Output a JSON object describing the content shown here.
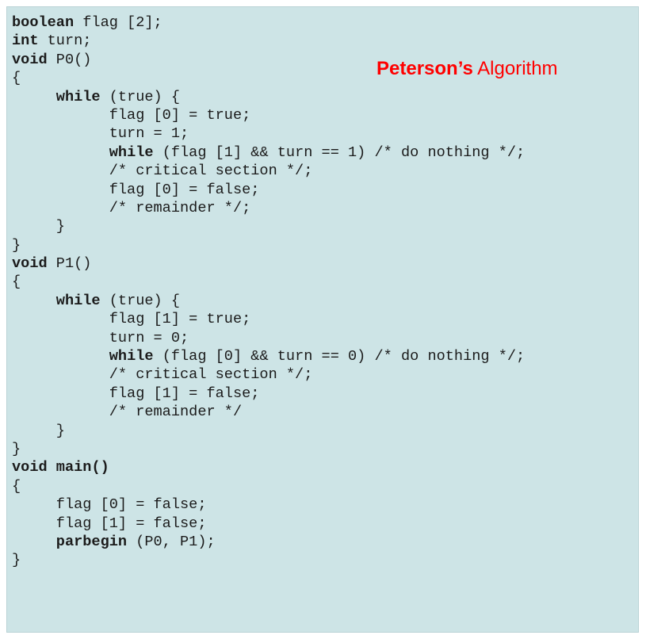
{
  "title": {
    "bold": "Peterson’s",
    "rest": " Algorithm"
  },
  "code_lines": [
    [
      {
        "t": "boolean",
        "k": 1
      },
      {
        "t": " flag [2];",
        "k": 0
      }
    ],
    [
      {
        "t": "int",
        "k": 1
      },
      {
        "t": " turn;",
        "k": 0
      }
    ],
    [
      {
        "t": "void",
        "k": 1
      },
      {
        "t": " P0()",
        "k": 0
      }
    ],
    [
      {
        "t": "{",
        "k": 0
      }
    ],
    [
      {
        "t": "     ",
        "k": 0
      },
      {
        "t": "while",
        "k": 1
      },
      {
        "t": " (true) {",
        "k": 0
      }
    ],
    [
      {
        "t": "           flag [0] = true;",
        "k": 0
      }
    ],
    [
      {
        "t": "           turn = 1;",
        "k": 0
      }
    ],
    [
      {
        "t": "           ",
        "k": 0
      },
      {
        "t": "while",
        "k": 1
      },
      {
        "t": " (flag [1] && turn == 1) /* do nothing */;",
        "k": 0
      }
    ],
    [
      {
        "t": "           /* critical section */;",
        "k": 0
      }
    ],
    [
      {
        "t": "           flag [0] = false;",
        "k": 0
      }
    ],
    [
      {
        "t": "           /* remainder */;",
        "k": 0
      }
    ],
    [
      {
        "t": "     }",
        "k": 0
      }
    ],
    [
      {
        "t": "}",
        "k": 0
      }
    ],
    [
      {
        "t": "void",
        "k": 1
      },
      {
        "t": " P1()",
        "k": 0
      }
    ],
    [
      {
        "t": "{",
        "k": 0
      }
    ],
    [
      {
        "t": "     ",
        "k": 0
      },
      {
        "t": "while",
        "k": 1
      },
      {
        "t": " (true) {",
        "k": 0
      }
    ],
    [
      {
        "t": "           flag [1] = true;",
        "k": 0
      }
    ],
    [
      {
        "t": "           turn = 0;",
        "k": 0
      }
    ],
    [
      {
        "t": "           ",
        "k": 0
      },
      {
        "t": "while",
        "k": 1
      },
      {
        "t": " (flag [0] && turn == 0) /* do nothing */;",
        "k": 0
      }
    ],
    [
      {
        "t": "           /* critical section */;",
        "k": 0
      }
    ],
    [
      {
        "t": "           flag [1] = false;",
        "k": 0
      }
    ],
    [
      {
        "t": "           /* remainder */",
        "k": 0
      }
    ],
    [
      {
        "t": "     }",
        "k": 0
      }
    ],
    [
      {
        "t": "}",
        "k": 0
      }
    ],
    [
      {
        "t": "void main",
        "k": 1
      },
      {
        "t": "()",
        "k": 1
      }
    ],
    [
      {
        "t": "{",
        "k": 0
      }
    ],
    [
      {
        "t": "     flag [0] = false;",
        "k": 0
      }
    ],
    [
      {
        "t": "     flag [1] = false;",
        "k": 0
      }
    ],
    [
      {
        "t": "     ",
        "k": 0
      },
      {
        "t": "parbegin",
        "k": 1
      },
      {
        "t": " (P0, P1);",
        "k": 0
      }
    ],
    [
      {
        "t": "}",
        "k": 0
      }
    ]
  ],
  "colors": {
    "panel_background": "#cde4e6",
    "title_color": "#ff0000",
    "code_text": "#1b1b1b"
  }
}
